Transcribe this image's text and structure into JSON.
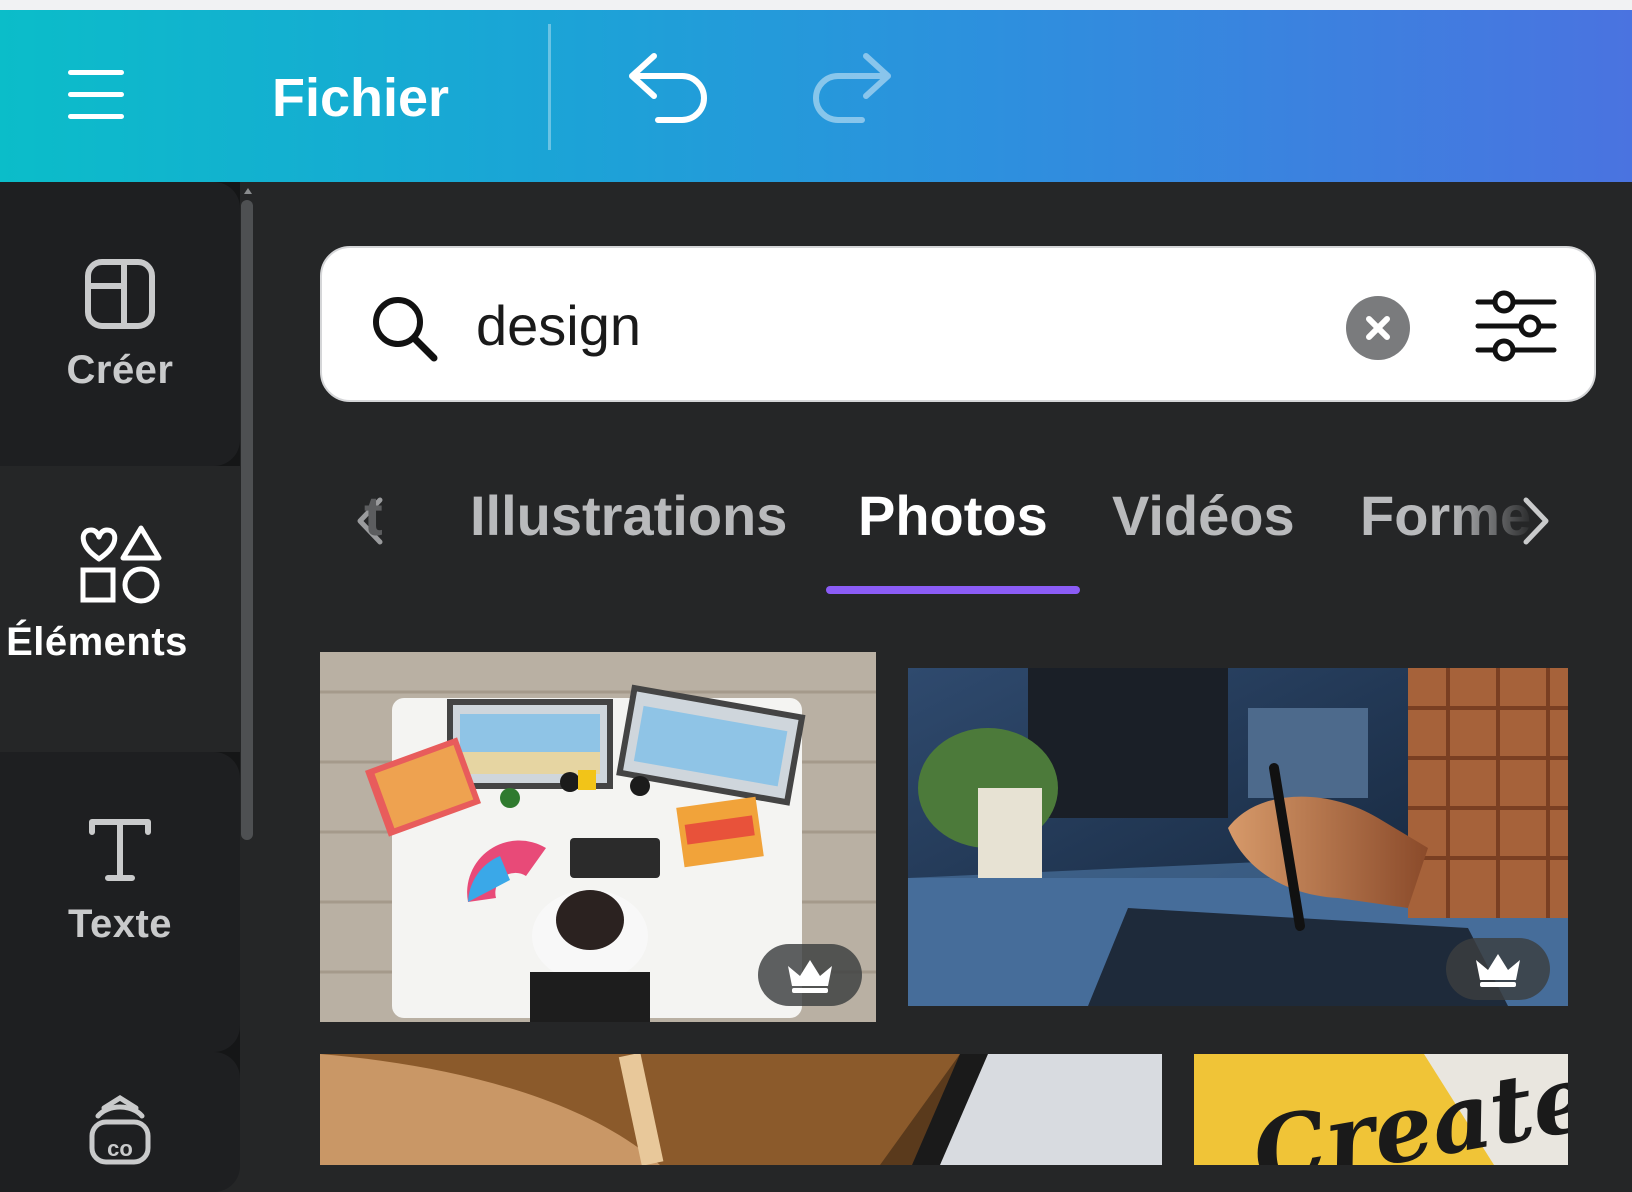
{
  "header": {
    "menu_icon": "hamburger-menu-icon",
    "file_label": "Fichier",
    "undo_icon": "undo-arrow-icon",
    "redo_icon": "redo-arrow-icon",
    "gradient": [
      "#0bbdc9",
      "#4a73e0"
    ]
  },
  "sidebar": {
    "items": [
      {
        "label": "Créer",
        "icon": "layout-icon"
      },
      {
        "label": "Éléments",
        "icon": "shapes-icon"
      },
      {
        "label": "Texte",
        "icon": "text-icon"
      },
      {
        "label": "",
        "icon": "brand-icon"
      }
    ],
    "active_index": 1
  },
  "search": {
    "value": "design",
    "placeholder": "",
    "search_icon": "search-icon",
    "clear_icon": "clear-icon",
    "filter_icon": "filter-sliders-icon"
  },
  "tabs": {
    "partial_left": "t",
    "items": [
      "Illustrations",
      "Photos",
      "Vidéos",
      "Forme"
    ],
    "active_index": 1,
    "active_color": "#8b5cf6",
    "prev_icon": "chevron-left-icon",
    "next_icon": "chevron-right-icon"
  },
  "results": {
    "photos": [
      {
        "subject": "designer-desk-overhead",
        "premium": true
      },
      {
        "subject": "hand-with-stylus-tablet",
        "premium": true
      },
      {
        "subject": "hand-holding-pen-notebook",
        "premium": false
      },
      {
        "subject": "create-lettering-yellow",
        "premium": false,
        "text": "Create"
      }
    ],
    "premium_icon": "crown-icon"
  }
}
